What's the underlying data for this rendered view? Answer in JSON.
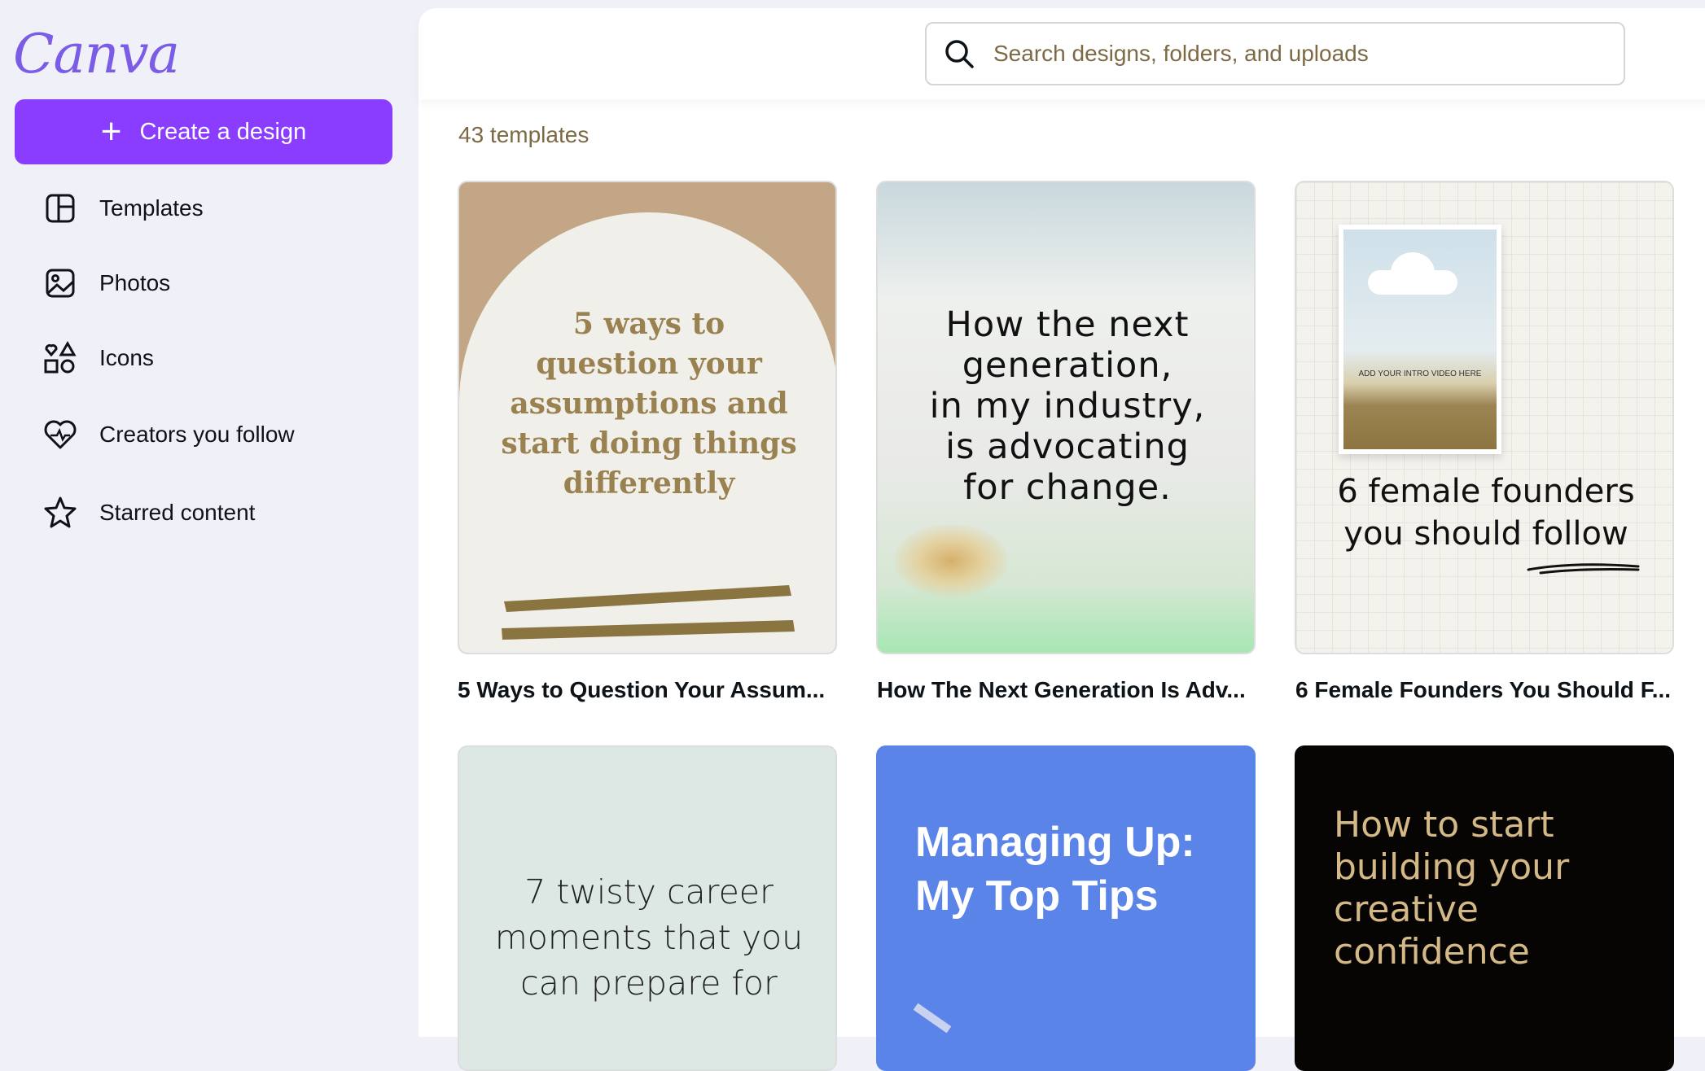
{
  "sidebar": {
    "logo": "Canva",
    "create_label": "Create a design",
    "items": [
      {
        "label": "Templates",
        "icon": "templates-icon"
      },
      {
        "label": "Photos",
        "icon": "photos-icon"
      },
      {
        "label": "Icons",
        "icon": "shapes-icon"
      },
      {
        "label": "Creators you follow",
        "icon": "heart-icon"
      },
      {
        "label": "Starred content",
        "icon": "star-icon"
      }
    ]
  },
  "search": {
    "placeholder": "Search designs, folders, and uploads"
  },
  "main": {
    "count_label": "43 templates",
    "templates": [
      {
        "title": "5 Ways to Question Your Assum...",
        "lines": [
          "5 ways to",
          "question your",
          "assumptions and",
          "start doing things",
          "differently"
        ]
      },
      {
        "title": "How The Next Generation Is Adv...",
        "lines": [
          "How the next",
          "generation,",
          "in my industry,",
          "is advocating",
          "for change."
        ]
      },
      {
        "title": "6 Female Founders You Should F...",
        "lines": [
          "6 female founders",
          "you should follow"
        ],
        "inner_caption": "ADD YOUR INTRO VIDEO HERE"
      },
      {
        "lines": [
          "7 twisty career",
          "moments that you",
          "can prepare for"
        ]
      },
      {
        "lines": [
          "Managing Up:",
          "My Top Tips"
        ]
      },
      {
        "lines": [
          "How to start",
          "building your",
          "creative",
          "confidence"
        ]
      }
    ]
  },
  "colors": {
    "brand": "#8b3dff",
    "olive": "#8a7440",
    "blue_card": "#5b84e8"
  }
}
